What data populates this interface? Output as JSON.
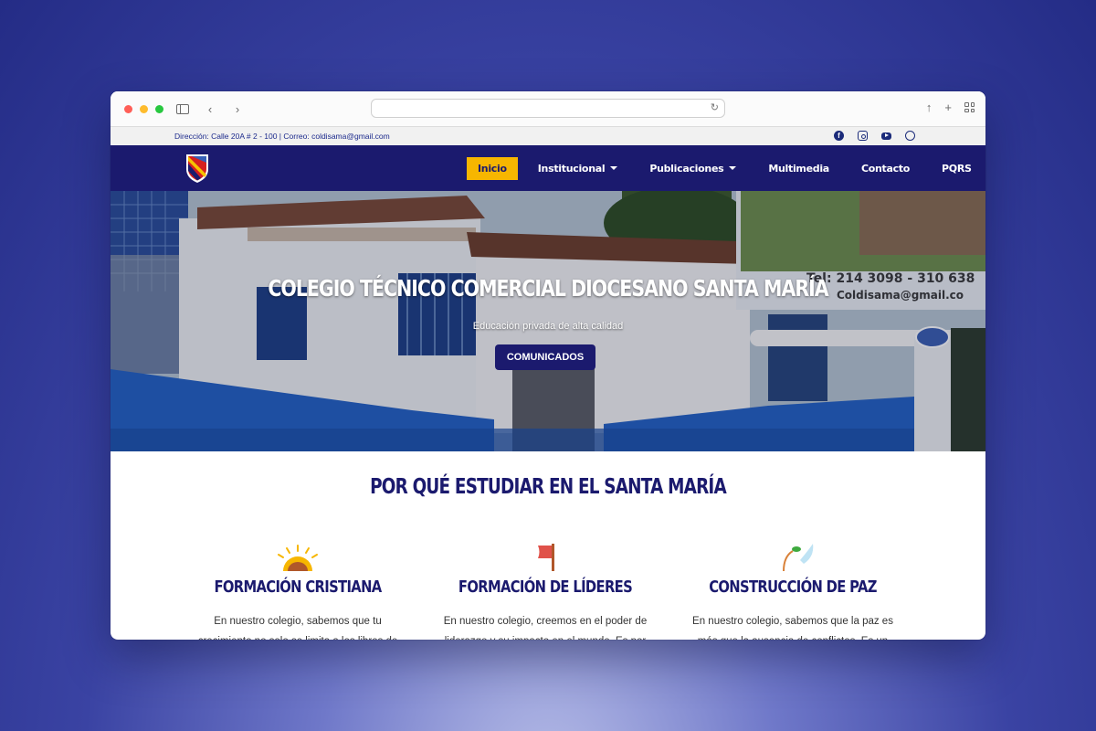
{
  "browser": {
    "address": ""
  },
  "topbar": {
    "info": "Dirección: Calle 20A # 2 - 100 | Correo: coldisama@gmail.com",
    "social": [
      "facebook-icon",
      "instagram-icon",
      "youtube-icon",
      "whatsapp-icon"
    ]
  },
  "nav": {
    "items": [
      {
        "label": "Inicio",
        "active": true
      },
      {
        "label": "Institucional",
        "dropdown": true
      },
      {
        "label": "Publicaciones",
        "dropdown": true
      },
      {
        "label": "Multimedia"
      },
      {
        "label": "Contacto"
      },
      {
        "label": "PQRS"
      }
    ]
  },
  "hero": {
    "title": "COLEGIO TÉCNICO COMERCIAL DIOCESANO SANTA MARÍA",
    "subtitle": "Educación privada de alta calidad",
    "button": "COMUNICADOS",
    "sign_phone": "Tel: 214 3098 - 310 638",
    "sign_email": "Coldisama@gmail.co"
  },
  "why": {
    "title": "POR QUÉ ESTUDIAR EN EL SANTA MARÍA",
    "features": [
      {
        "title": "FORMACIÓN CRISTIANA",
        "icon": "sunrise-icon",
        "text": "En nuestro colegio, sabemos que tu crecimiento no solo se limita a los libros de"
      },
      {
        "title": "FORMACIÓN DE LÍDERES",
        "icon": "flag-icon",
        "text": "En nuestro colegio, creemos en el poder de liderazgo y su impacto en el mundo. Es por"
      },
      {
        "title": "CONSTRUCCIÓN DE PAZ",
        "icon": "sprout-icon",
        "text": "En nuestro colegio, sabemos que la paz es más que la ausencia de conflictos. Es un"
      }
    ]
  },
  "colors": {
    "navy": "#1b1a6e",
    "gold": "#f7b600"
  }
}
